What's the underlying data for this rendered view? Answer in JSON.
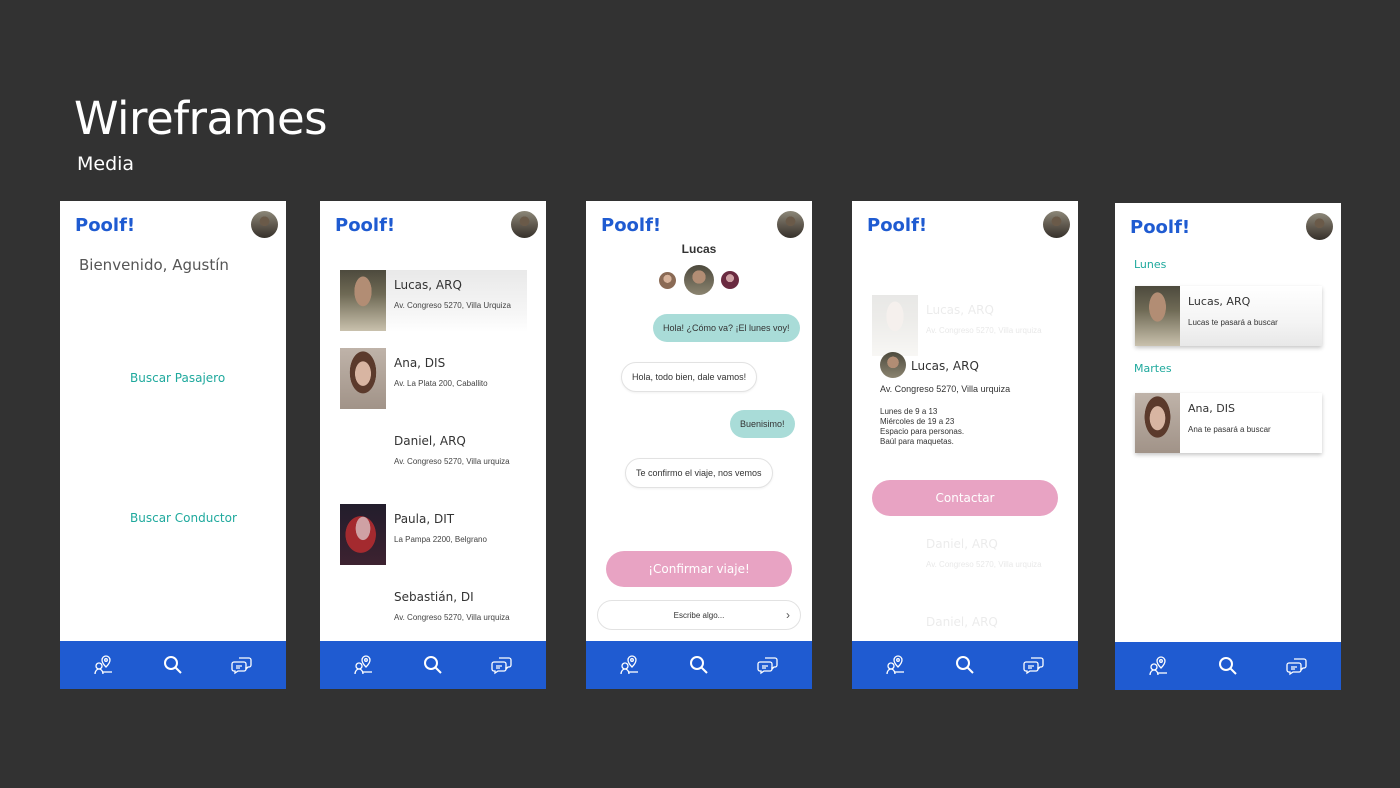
{
  "deck": {
    "title": "Wireframes",
    "subtitle": "Media"
  },
  "app": {
    "logo": "Poolf!"
  },
  "nav": {
    "icons": [
      "map-pin-icon",
      "search-icon",
      "chat-icon"
    ]
  },
  "screen1": {
    "welcome": "Bienvenido, Agustín",
    "search_passenger": "Buscar Pasajero",
    "search_driver": "Buscar Conductor"
  },
  "screen2": {
    "people": [
      {
        "name": "Lucas, ARQ",
        "address": "Av. Congreso 5270, Villa Urquiza"
      },
      {
        "name": "Ana, DIS",
        "address": "Av. La Plata 200, Caballito"
      },
      {
        "name": "Daniel, ARQ",
        "address": "Av. Congreso 5270, Villa urquiza"
      },
      {
        "name": "Paula, DIT",
        "address": "La Pampa 2200, Belgrano"
      },
      {
        "name": "Sebastián, DI",
        "address": "Av. Congreso 5270, Villa urquiza"
      }
    ]
  },
  "screen3": {
    "contact_name": "Lucas",
    "messages": [
      {
        "from": "me",
        "text": "Hola! ¿Cómo va? ¡El lunes voy!"
      },
      {
        "from": "them",
        "text": "Hola, todo bien, dale vamos!"
      },
      {
        "from": "me",
        "text": "Buenisimo!"
      },
      {
        "from": "them",
        "text": "Te confirmo el viaje, nos vemos"
      }
    ],
    "confirm_button": "¡Confirmar viaje!",
    "input_placeholder": "Escribe algo...",
    "send_glyph": "›"
  },
  "screen4": {
    "faded_top": {
      "name": "Lucas, ARQ",
      "address": "Av. Congreso 5270, Villa urquiza"
    },
    "driver_name": "Lucas, ARQ",
    "driver_address": "Av. Congreso 5270, Villa urquiza",
    "schedule": [
      "Lunes de 9 a 13",
      "Miércoles de 19 a 23",
      "Espacio para  personas.",
      "Baúl para maquetas."
    ],
    "contact_button": "Contactar",
    "faded_bottom": [
      {
        "name": "Daniel, ARQ",
        "address": "Av. Congreso 5270, Villa urquiza"
      },
      {
        "name": "Daniel, ARQ",
        "address": ""
      }
    ]
  },
  "screen5": {
    "days": [
      {
        "label": "Lunes",
        "name": "Lucas, ARQ",
        "sub": "Lucas te pasará a buscar"
      },
      {
        "label": "Martes",
        "name": "Ana, DIS",
        "sub": "Ana te pasará a buscar"
      }
    ]
  }
}
